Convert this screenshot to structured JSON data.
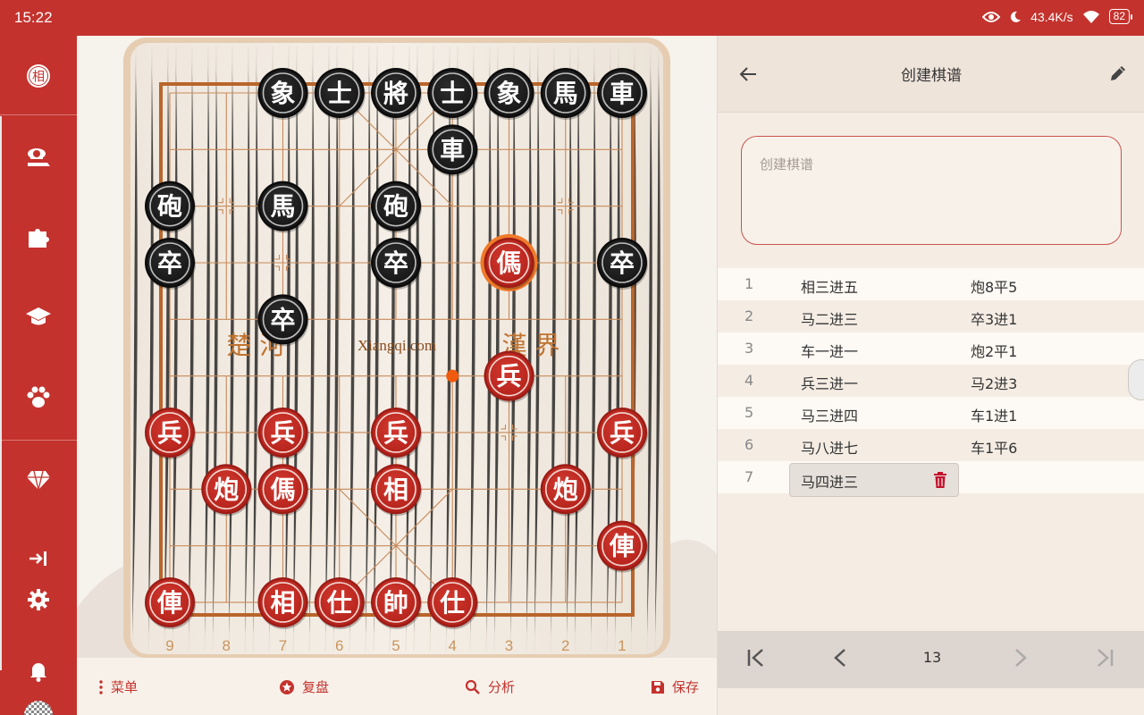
{
  "status": {
    "time": "15:22",
    "net_speed": "43.4K/s",
    "battery": "82"
  },
  "sidebar": {
    "logo": "相"
  },
  "board": {
    "river_left": "楚 河",
    "river_right": "漢 界",
    "watermark": "Xiangqi.com",
    "file_numbers": [
      "9",
      "8",
      "7",
      "6",
      "5",
      "4",
      "3",
      "2",
      "1"
    ],
    "black_pieces": [
      {
        "c": 2,
        "r": 0,
        "t": "象"
      },
      {
        "c": 3,
        "r": 0,
        "t": "士"
      },
      {
        "c": 4,
        "r": 0,
        "t": "將"
      },
      {
        "c": 5,
        "r": 0,
        "t": "士"
      },
      {
        "c": 6,
        "r": 0,
        "t": "象"
      },
      {
        "c": 7,
        "r": 0,
        "t": "馬"
      },
      {
        "c": 8,
        "r": 0,
        "t": "車"
      },
      {
        "c": 5,
        "r": 1,
        "t": "車"
      },
      {
        "c": 0,
        "r": 2,
        "t": "砲"
      },
      {
        "c": 2,
        "r": 2,
        "t": "馬"
      },
      {
        "c": 4,
        "r": 2,
        "t": "砲"
      },
      {
        "c": 0,
        "r": 3,
        "t": "卒"
      },
      {
        "c": 4,
        "r": 3,
        "t": "卒"
      },
      {
        "c": 8,
        "r": 3,
        "t": "卒"
      },
      {
        "c": 2,
        "r": 4,
        "t": "卒"
      }
    ],
    "red_pieces": [
      {
        "c": 6,
        "r": 3,
        "t": "傌",
        "selected": true
      },
      {
        "c": 6,
        "r": 5,
        "t": "兵"
      },
      {
        "c": 0,
        "r": 6,
        "t": "兵"
      },
      {
        "c": 2,
        "r": 6,
        "t": "兵"
      },
      {
        "c": 4,
        "r": 6,
        "t": "兵"
      },
      {
        "c": 8,
        "r": 6,
        "t": "兵"
      },
      {
        "c": 1,
        "r": 7,
        "t": "炮"
      },
      {
        "c": 2,
        "r": 7,
        "t": "傌"
      },
      {
        "c": 4,
        "r": 7,
        "t": "相"
      },
      {
        "c": 7,
        "r": 7,
        "t": "炮"
      },
      {
        "c": 8,
        "r": 8,
        "t": "俥"
      },
      {
        "c": 0,
        "r": 9,
        "t": "俥"
      },
      {
        "c": 2,
        "r": 9,
        "t": "相"
      },
      {
        "c": 3,
        "r": 9,
        "t": "仕"
      },
      {
        "c": 4,
        "r": 9,
        "t": "帥"
      },
      {
        "c": 5,
        "r": 9,
        "t": "仕"
      }
    ],
    "last_move_marker": {
      "c": 5,
      "r": 5
    }
  },
  "bottom_bar": {
    "menu": "菜单",
    "replay": "复盘",
    "analyze": "分析",
    "save": "保存"
  },
  "panel": {
    "title": "创建棋谱",
    "input_placeholder": "创建棋谱",
    "moves": [
      {
        "num": "1",
        "red": "相三进五",
        "black": "炮8平5"
      },
      {
        "num": "2",
        "red": "马二进三",
        "black": "卒3进1"
      },
      {
        "num": "3",
        "red": "车一进一",
        "black": "炮2平1"
      },
      {
        "num": "4",
        "red": "兵三进一",
        "black": "马2进3"
      },
      {
        "num": "5",
        "red": "马三进四",
        "black": "车1进1"
      },
      {
        "num": "6",
        "red": "马八进七",
        "black": "车1平6"
      },
      {
        "num": "7",
        "red": "马四进三",
        "black": ""
      }
    ],
    "page": "13"
  },
  "colors": {
    "accent": "#c4322d",
    "black_piece": "#1f1f1f",
    "board_line": "#c1692b"
  }
}
